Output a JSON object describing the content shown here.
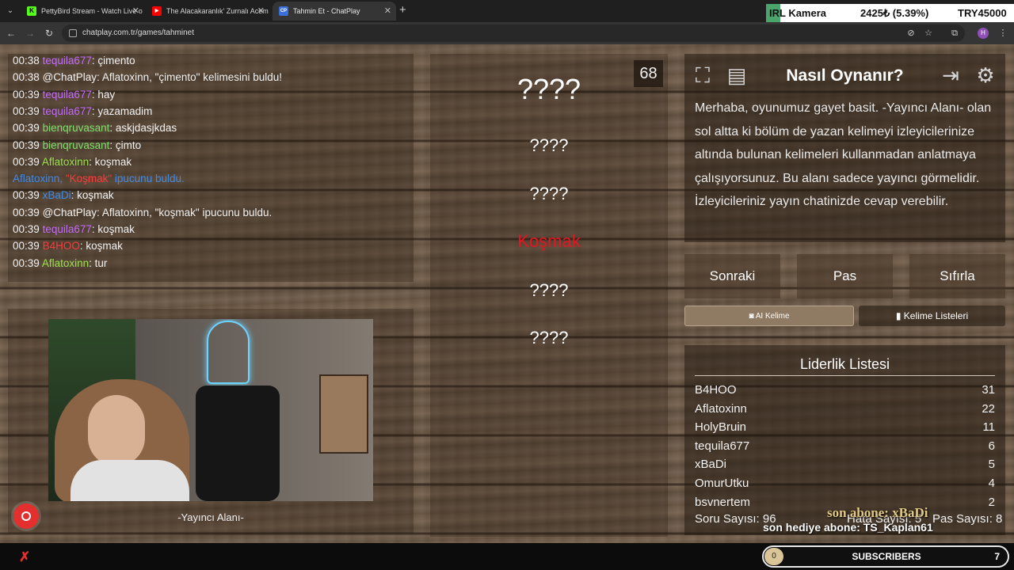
{
  "browser": {
    "tabs": [
      {
        "title": "PettyBird Stream - Watch Live o",
        "fav": "K",
        "fav_color": "#53fc18",
        "active": false
      },
      {
        "title": "The Alacakaranlık' Zurnalı Acem",
        "fav": "▶",
        "fav_color": "#ff0000",
        "active": false
      },
      {
        "title": "Tahmin Et - ChatPlay",
        "fav": "CP",
        "fav_color": "#3b6fd8",
        "active": true
      }
    ],
    "new_tab_icon": "+",
    "url": "chatplay.com.tr/games/tahminet",
    "profile_initial": "H"
  },
  "ticker": {
    "name": "IRL Kamera",
    "price": "2425₺ (5.39%)",
    "goal": "TRY45000"
  },
  "chat": {
    "lines": [
      {
        "time": "00:38",
        "user": "tequila677",
        "user_class": "u-tequila",
        "msg": "çimento"
      },
      {
        "time": "00:38",
        "user": "@ChatPlay",
        "user_class": "u-chatplay",
        "msg": "Aflatoxinn, \"çimento\" kelimesini buldu!"
      },
      {
        "time": "00:39",
        "user": "tequila677",
        "user_class": "u-tequila",
        "msg": "hay"
      },
      {
        "time": "00:39",
        "user": "tequila677",
        "user_class": "u-tequila",
        "msg": "yazamadim"
      },
      {
        "time": "00:39",
        "user": "bienqruvasant",
        "user_class": "u-bienq",
        "msg": "askjdasjkdas"
      },
      {
        "time": "00:39",
        "user": "bienqruvasant",
        "user_class": "u-bienq",
        "msg": "çimto"
      },
      {
        "time": "00:39",
        "user": "Aflatoxinn",
        "user_class": "u-afla",
        "msg": "koşmak"
      },
      {
        "system": true,
        "pre": "Aflatoxinn, ",
        "hl": "\"Koşmak\"",
        "post": " ipucunu buldu."
      },
      {
        "time": "00:39",
        "user": "xBaDi",
        "user_class": "u-xbadi",
        "msg": "koşmak"
      },
      {
        "time": "00:39",
        "user": "@ChatPlay",
        "user_class": "u-chatplay",
        "msg": "Aflatoxinn, \"koşmak\" ipucunu buldu."
      },
      {
        "time": "00:39",
        "user": "tequila677",
        "user_class": "u-tequila",
        "msg": "koşmak"
      },
      {
        "time": "00:39",
        "user": "B4HOO",
        "user_class": "u-b4hoo",
        "msg": "koşmak"
      },
      {
        "time": "00:39",
        "user": "Aflatoxinn",
        "user_class": "u-afla",
        "msg": "tur"
      }
    ]
  },
  "streamer_area_label": "-Yayıncı Alanı-",
  "game": {
    "counter": "68",
    "words": [
      {
        "text": "????",
        "style": "big"
      },
      {
        "text": "????",
        "style": ""
      },
      {
        "text": "????",
        "style": ""
      },
      {
        "text": "Koşmak",
        "style": "red"
      },
      {
        "text": "????",
        "style": ""
      },
      {
        "text": "????",
        "style": ""
      }
    ]
  },
  "howto": {
    "title": "Nasıl Oynanır?",
    "text": "Merhaba, oyunumuz gayet basit. -Yayıncı Alanı- olan sol altta ki bölüm de yazan kelimeyi izleyicilerinize altında bulunan kelimeleri kullanmadan anlatmaya çalışıyorsunuz. Bu alanı sadece yayıncı görmelidir. İzleyicileriniz yayın chatinizde cevap verebilir."
  },
  "actions": {
    "next": "Sonraki",
    "pass": "Pas",
    "reset": "Sıfırla",
    "ai_word": "AI Kelime",
    "word_lists": "Kelime Listeleri"
  },
  "leaderboard": {
    "title": "Liderlik Listesi",
    "rows": [
      {
        "name": "B4HOO",
        "score": "31"
      },
      {
        "name": "Aflatoxinn",
        "score": "22"
      },
      {
        "name": "HolyBruin",
        "score": "11"
      },
      {
        "name": "tequila677",
        "score": "6"
      },
      {
        "name": "xBaDi",
        "score": "5"
      },
      {
        "name": "OmurUtku",
        "score": "4"
      },
      {
        "name": "bsvnertem",
        "score": "2"
      }
    ]
  },
  "stats": {
    "questions": "Soru Sayısı: 96",
    "errors": "Hata Sayısı: 5",
    "passes": "Pas Sayısı: 8"
  },
  "overlay": {
    "last_sub": "son abone: xBaDi",
    "last_gift": "son hediye abone: TS_Kaplan61"
  },
  "subgoal": {
    "current": "0",
    "label": "SUBSCRIBERS",
    "target": "7"
  }
}
